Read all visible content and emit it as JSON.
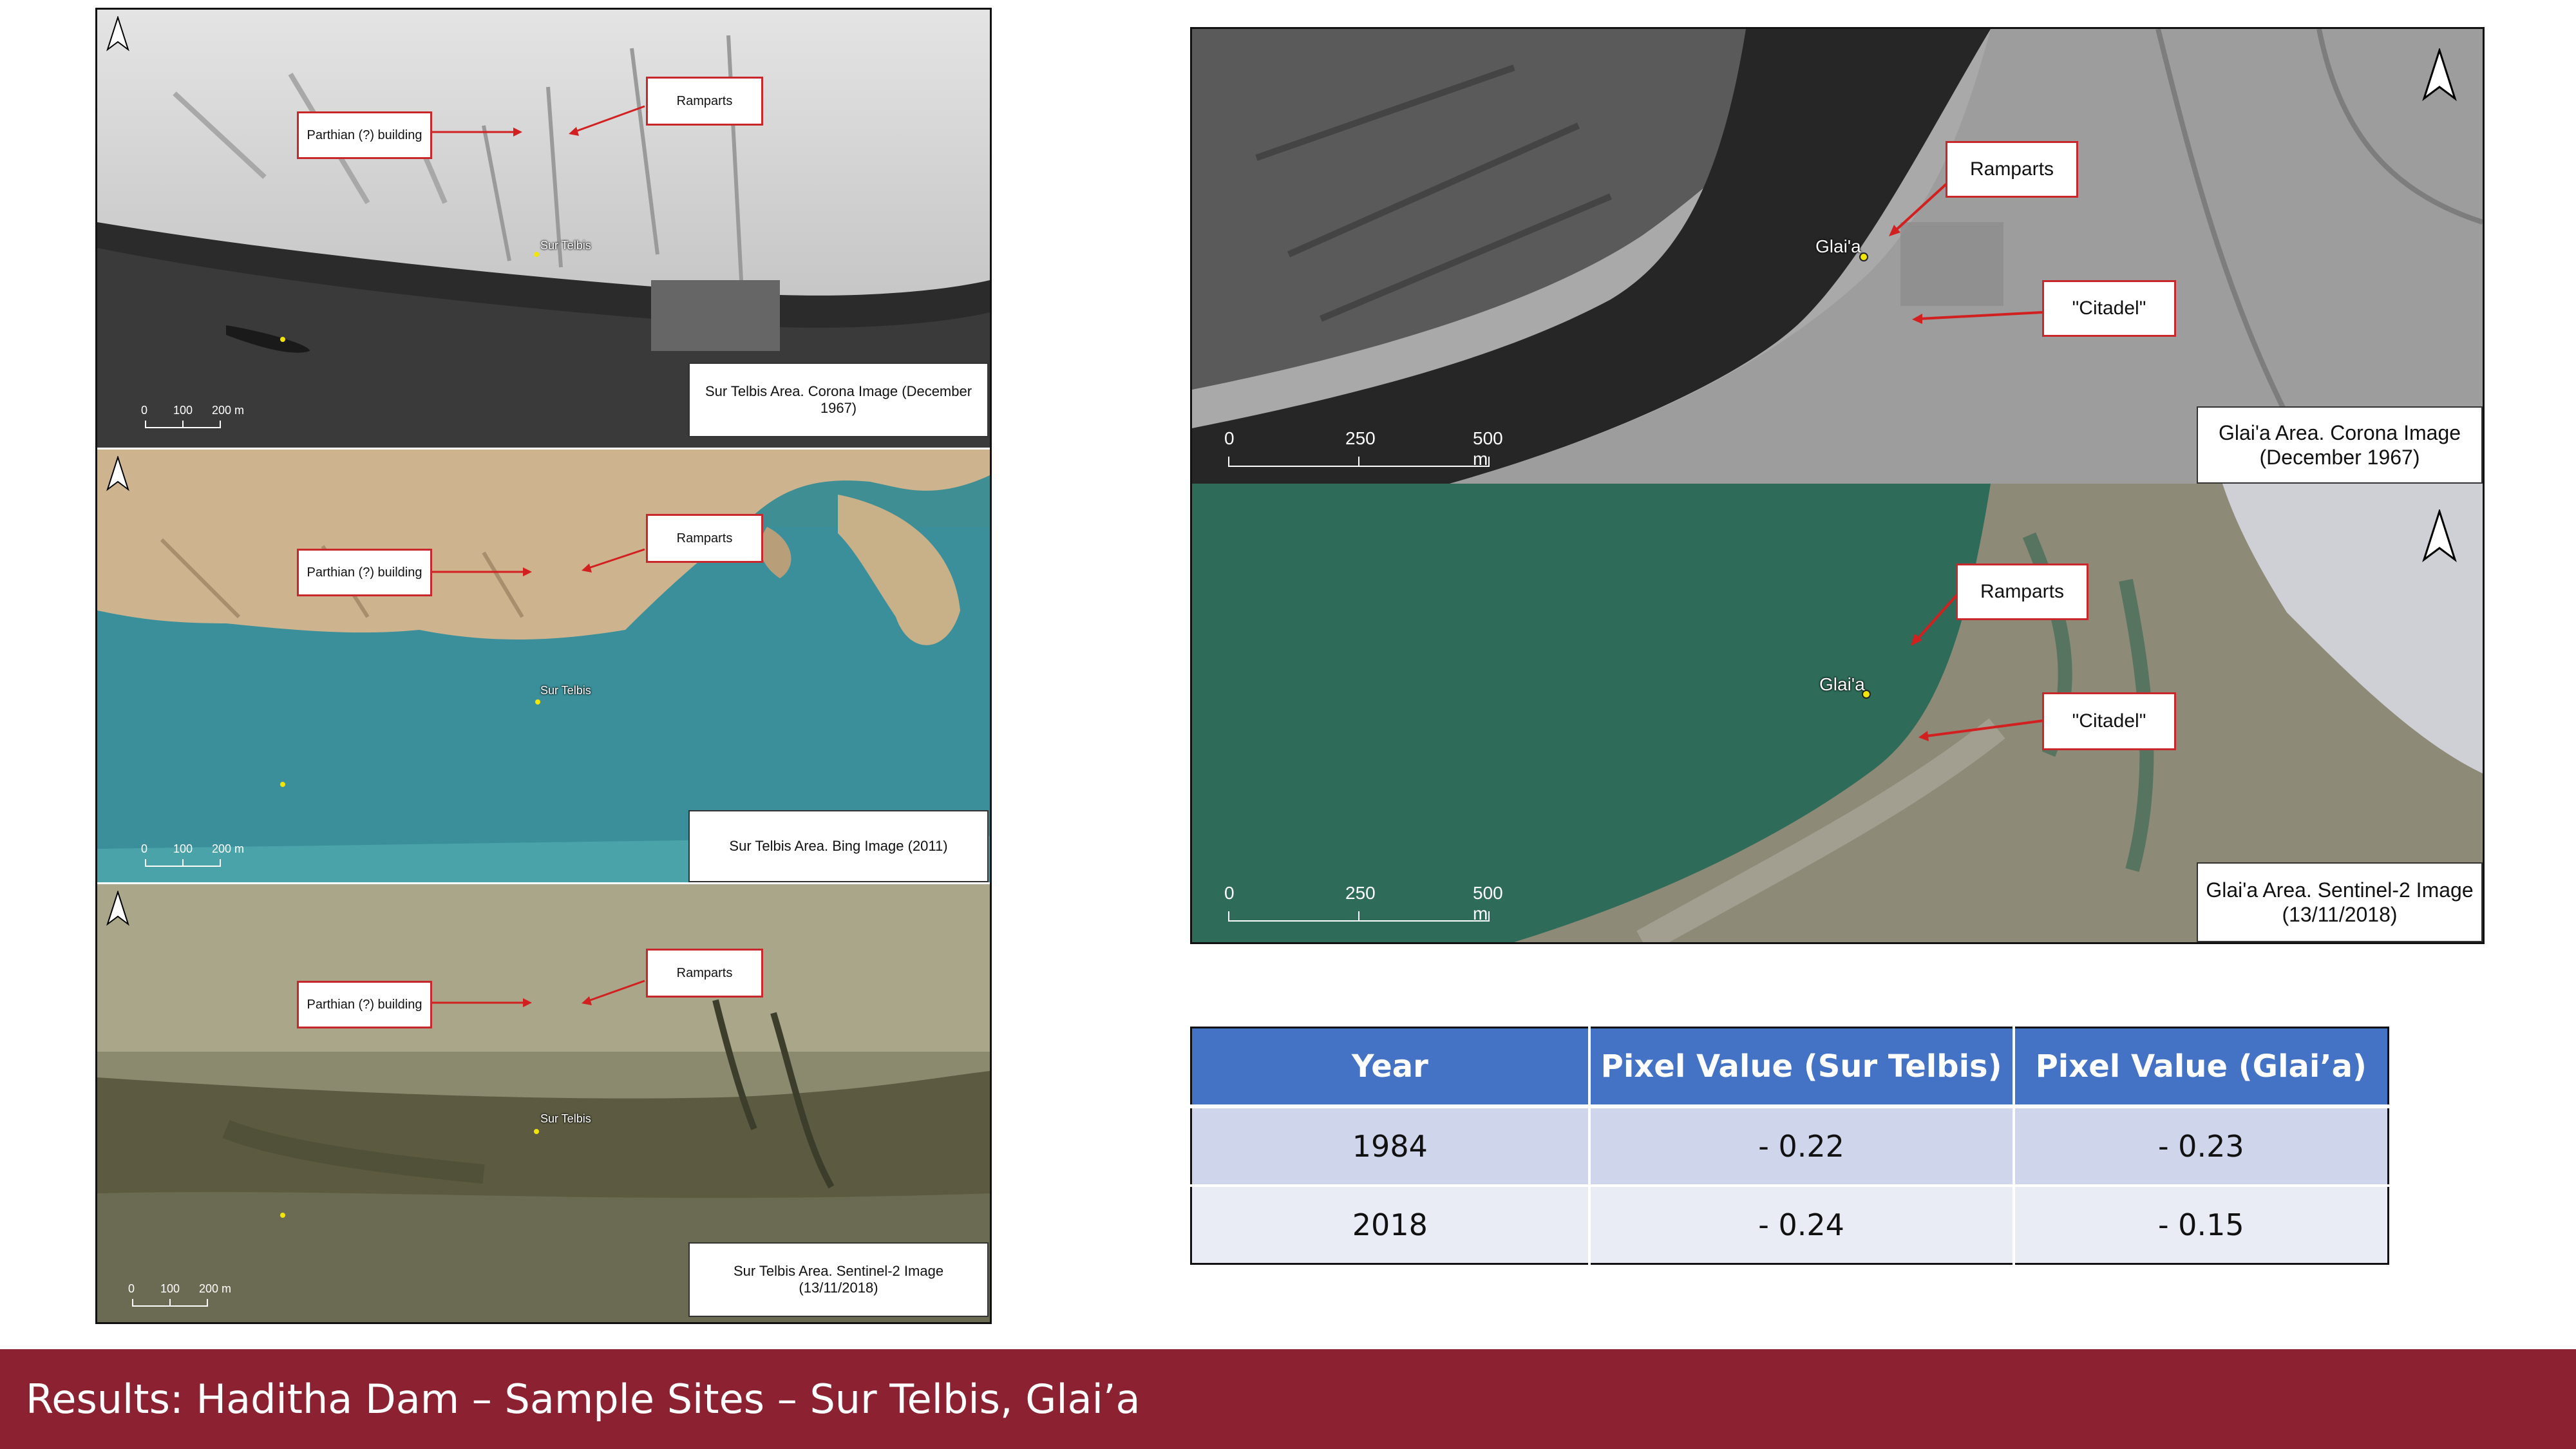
{
  "left_column": {
    "panels": [
      {
        "callout_building": "Parthian (?) building",
        "callout_ramparts": "Ramparts",
        "site_label": "Sur Telbis",
        "scale_labels": [
          "0",
          "100",
          "200 m"
        ],
        "caption": "Sur Telbis Area. Corona Image (December 1967)"
      },
      {
        "callout_building": "Parthian (?) building",
        "callout_ramparts": "Ramparts",
        "site_label": "Sur Telbis",
        "scale_labels": [
          "0",
          "100",
          "200 m"
        ],
        "caption": "Sur Telbis Area. Bing Image (2011)"
      },
      {
        "callout_building": "Parthian (?) building",
        "callout_ramparts": "Ramparts",
        "site_label": "Sur Telbis",
        "scale_labels": [
          "0",
          "100",
          "200 m"
        ],
        "caption": "Sur Telbis Area. Sentinel-2 Image (13/11/2018)"
      }
    ]
  },
  "right_column": {
    "panels": [
      {
        "callout_ramparts": "Ramparts",
        "callout_citadel": "\"Citadel\"",
        "site_label": "Glai'a",
        "scale_labels": [
          "0",
          "250",
          "500 m"
        ],
        "caption": "Glai'a Area. Corona Image (December 1967)"
      },
      {
        "callout_ramparts": "Ramparts",
        "callout_citadel": "\"Citadel\"",
        "site_label": "Glai'a",
        "scale_labels": [
          "0",
          "250",
          "500 m"
        ],
        "caption": "Glai'a Area. Sentinel-2 Image (13/11/2018)"
      }
    ]
  },
  "table": {
    "headers": [
      "Year",
      "Pixel Value (Sur Telbis)",
      "Pixel Value (Glai’a)"
    ],
    "rows": [
      [
        "1984",
        "- 0.22",
        "- 0.23"
      ],
      [
        "2018",
        "- 0.24",
        "- 0.15"
      ]
    ]
  },
  "footer": {
    "title": "Results: Haditha Dam – Sample Sites – Sur Telbis, Glai’a"
  },
  "colors": {
    "footer_bg": "#8c2231",
    "table_header": "#4472c4",
    "callout_border": "#c8282c",
    "site_dot": "#f2e600"
  }
}
